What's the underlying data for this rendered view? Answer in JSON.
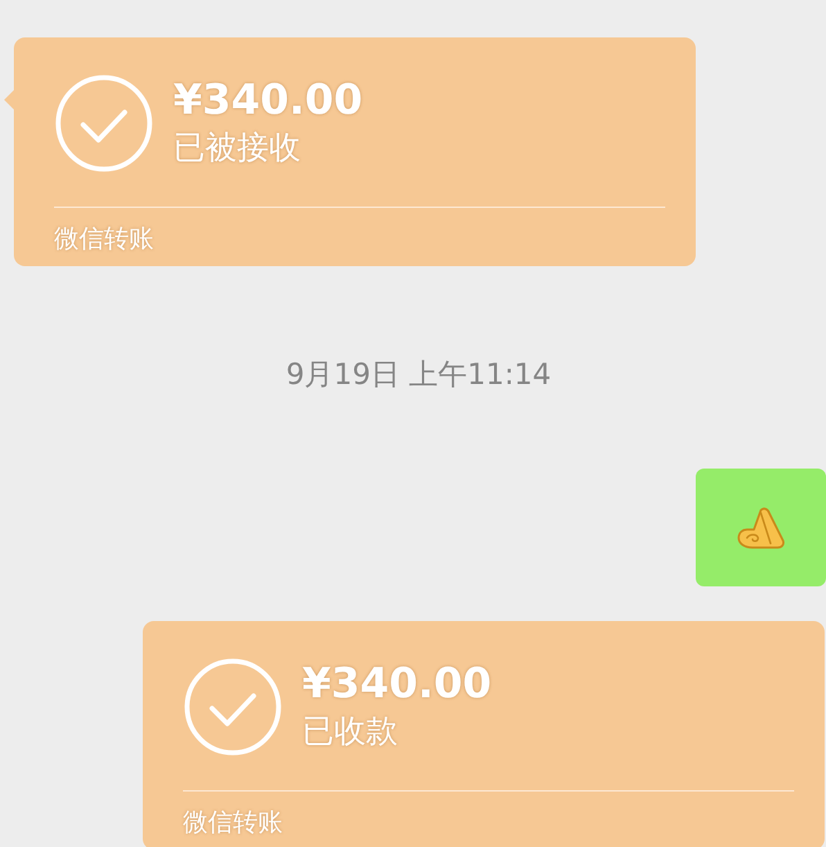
{
  "messages": [
    {
      "kind": "transfer",
      "outgoing": false,
      "amount": "¥340.00",
      "status": "已被接收",
      "footer": "微信转账"
    },
    {
      "kind": "time",
      "text": "9月19日 上午11:14"
    },
    {
      "kind": "sticker",
      "outgoing": true
    },
    {
      "kind": "transfer",
      "outgoing": true,
      "amount": "¥340.00",
      "status": "已收款",
      "footer": "微信转账"
    }
  ]
}
